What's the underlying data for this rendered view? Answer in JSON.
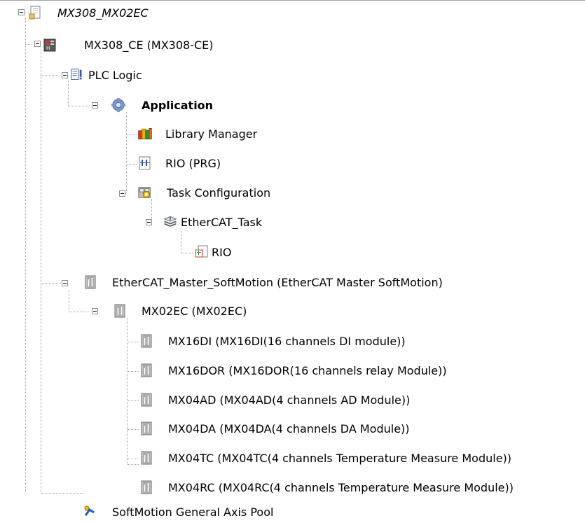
{
  "tree": [
    {
      "id": "mx308-mx02ec",
      "label": "MX308_MX02EC",
      "icon": "project-icon",
      "italic": true
    },
    {
      "id": "mx308-ce",
      "label": "MX308_CE (MX308-CE)",
      "icon": "plc-device-icon"
    },
    {
      "id": "plc-logic",
      "label": "PLC Logic",
      "icon": "plc-logic-icon"
    },
    {
      "id": "application",
      "label": "Application",
      "icon": "gear-icon",
      "bold": true
    },
    {
      "id": "library-manager",
      "label": "Library Manager",
      "icon": "library-books-icon"
    },
    {
      "id": "rio-prg",
      "label": "RIO (PRG)",
      "icon": "program-pou-icon"
    },
    {
      "id": "task-configuration",
      "label": "Task Configuration",
      "icon": "task-config-icon"
    },
    {
      "id": "ethercat-task",
      "label": "EtherCAT_Task",
      "icon": "task-icon"
    },
    {
      "id": "rio",
      "label": "RIO",
      "icon": "program-call-icon"
    },
    {
      "id": "ethercat-master",
      "label": "EtherCAT_Master_SoftMotion (EtherCAT Master SoftMotion)",
      "icon": "module-icon"
    },
    {
      "id": "mx02ec",
      "label": "MX02EC (MX02EC)",
      "icon": "module-icon"
    },
    {
      "id": "mx16di",
      "label": "MX16DI (MX16DI(16 channels DI module))",
      "icon": "module-icon"
    },
    {
      "id": "mx16dor",
      "label": "MX16DOR (MX16DOR(16 channels relay Module))",
      "icon": "module-icon"
    },
    {
      "id": "mx04ad",
      "label": "MX04AD (MX04AD(4 channels AD Module))",
      "icon": "module-icon"
    },
    {
      "id": "mx04da",
      "label": "MX04DA (MX04DA(4 channels DA Module))",
      "icon": "module-icon"
    },
    {
      "id": "mx04tc",
      "label": "MX04TC (MX04TC(4 channels Temperature Measure Module))",
      "icon": "module-icon"
    },
    {
      "id": "mx04rc",
      "label": "MX04RC (MX04RC(4 channels Temperature Measure Module))",
      "icon": "module-icon"
    },
    {
      "id": "softmotion-axis-pool",
      "label": "SoftMotion General Axis Pool",
      "icon": "axis-pool-icon"
    }
  ]
}
